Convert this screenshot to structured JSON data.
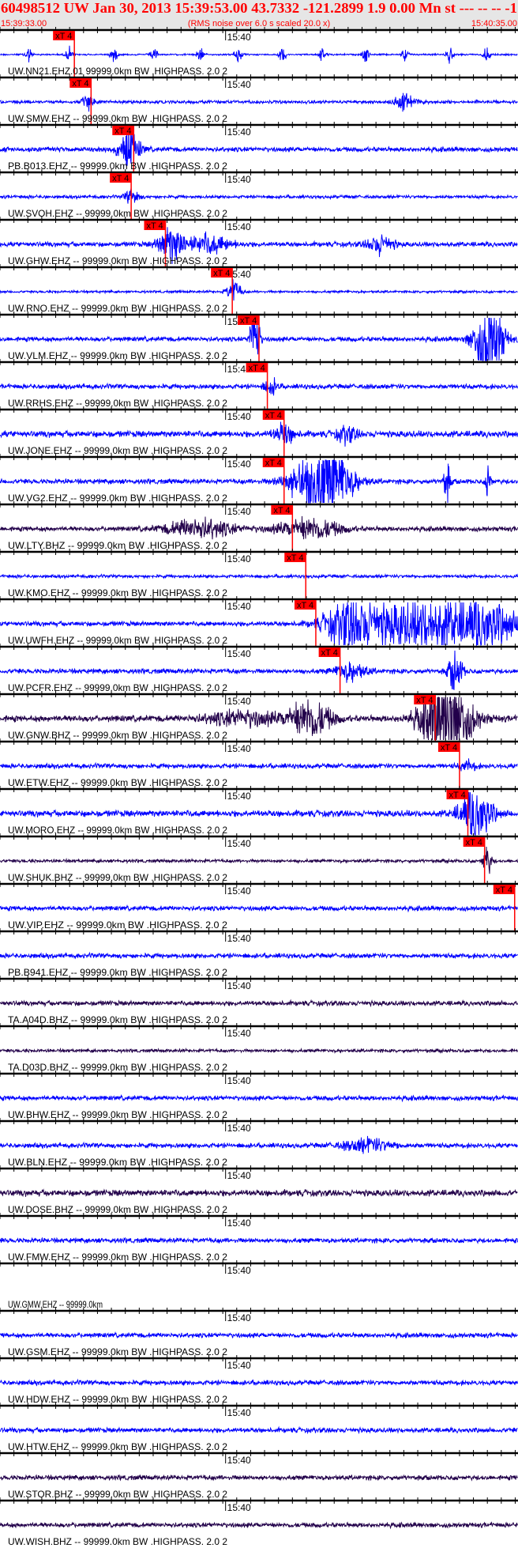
{
  "header": {
    "title": "60498512 UW Jan 30, 2013 15:39:53.00   43.7332 -121.2899  1.9 0.00 Mn st --- -- --  -1",
    "start_time": "15:39:33.00",
    "note": "(RMS noise over 6.0 s scaled 20.0 x)",
    "end_time": "15:40:35.00"
  },
  "colors": {
    "header_bg": "#e6e6e6",
    "accent": "#ff0000",
    "trace_blue": "#0000ff",
    "trace_dark": "#22004a",
    "axis": "#000000"
  },
  "chart_data": {
    "type": "line",
    "title": "60498512 UW Jan 30, 2013 15:39:53.00",
    "x_range_seconds": [
      0,
      62
    ],
    "x_start": "15:39:33.00",
    "x_end": "15:40:35.00",
    "time_mark_label": "15:40",
    "time_mark_seconds": 27,
    "major_tick_seconds": 10,
    "pick_label": "xT 4",
    "traces": [
      {
        "label": "UW.NN21.EHZ.01 99999.0km BW .HIGHPASS. 2.0  2",
        "color": "blue",
        "noise": 1,
        "pick": 8.9,
        "bursts": [
          [
            3.4,
            10,
            0.4
          ],
          [
            8.3,
            10,
            0.4
          ],
          [
            13.6,
            10,
            0.4
          ],
          [
            18.4,
            10,
            0.4
          ],
          [
            23.9,
            10,
            0.4
          ],
          [
            28.5,
            12,
            0.4
          ],
          [
            33.8,
            10,
            0.4
          ],
          [
            38.6,
            8,
            0.4
          ],
          [
            43.7,
            10,
            0.4
          ],
          [
            48.5,
            8,
            0.4
          ],
          [
            53.8,
            10,
            0.4
          ],
          [
            58.3,
            10,
            0.4
          ]
        ]
      },
      {
        "label": "UW.SMW.EHZ -- 99999.0km BW .HIGHPASS. 2.0  2",
        "color": "blue",
        "noise": 2,
        "pick": 10.9,
        "bursts": [
          [
            10.6,
            12,
            0.6
          ],
          [
            48.4,
            10,
            1.2
          ]
        ]
      },
      {
        "label": "PB.B013.EHZ -- 99999.0km BW .HIGHPASS. 2.0  2",
        "color": "blue",
        "noise": 3,
        "pick": 16.0,
        "bursts": [
          [
            15.5,
            25,
            1.2
          ]
        ]
      },
      {
        "label": "UW.SVOH.EHZ -- 99999.0km BW .HIGHPASS. 2.0  2",
        "color": "blue",
        "noise": 2,
        "pick": 15.7,
        "bursts": [
          [
            15.8,
            10,
            0.8
          ]
        ]
      },
      {
        "label": "UW.GHW.EHZ -- 99999.0km BW .HIGHPASS. 2.0  2",
        "color": "blue",
        "noise": 3,
        "pick": 19.8,
        "bursts": [
          [
            20.5,
            22,
            1.5
          ],
          [
            25,
            12,
            2.5
          ],
          [
            45.5,
            12,
            1.5
          ]
        ]
      },
      {
        "label": "UW.RNO.EHZ -- 99999.0km BW .HIGHPASS. 2.0  2",
        "color": "blue",
        "noise": 1.5,
        "pick": 27.8,
        "bursts": [
          [
            28,
            15,
            0.8
          ]
        ]
      },
      {
        "label": "UW.VLM.EHZ -- 99999.0km BW .HIGHPASS. 2.0  2",
        "color": "blue",
        "noise": 3,
        "pick": 31.0,
        "bursts": [
          [
            30.5,
            60,
            0.5
          ],
          [
            58.5,
            60,
            1.6
          ]
        ]
      },
      {
        "label": "UW.RRHS.EHZ -- 99999.0km BW .HIGHPASS. 2.0  2",
        "color": "blue",
        "noise": 3,
        "pick": 32.0,
        "bursts": [
          [
            32.5,
            10,
            0.8
          ]
        ]
      },
      {
        "label": "UW.JONE.EHZ -- 99999.0km BW .HIGHPASS. 2.0  2",
        "color": "blue",
        "noise": 4,
        "pick": 34.0,
        "bursts": [
          [
            34,
            12,
            1.2
          ],
          [
            41.5,
            10,
            1.2
          ]
        ]
      },
      {
        "label": "UW.VG2.EHZ -- 99999.0km BW .HIGHPASS. 2.0  2",
        "color": "blue",
        "noise": 3,
        "pick": 34.0,
        "bursts": [
          [
            38.5,
            60,
            3.2
          ],
          [
            53.5,
            25,
            0.4
          ],
          [
            58.5,
            30,
            0.3
          ]
        ]
      },
      {
        "label": "UW.LTY.BHZ -- 99999.0km BW .HIGHPASS. 2.0  2",
        "color": "dark",
        "noise": 3,
        "pick": 35.0,
        "bursts": [
          [
            24,
            12,
            4
          ],
          [
            37,
            14,
            3.5
          ]
        ]
      },
      {
        "label": "UW.KMO.EHZ -- 99999.0km BW .HIGHPASS. 2.0  2",
        "color": "blue",
        "noise": 2,
        "pick": 36.6,
        "bursts": []
      },
      {
        "label": "UW.UWFH.EHZ -- 99999.0km BW .HIGHPASS. 2.0  2",
        "color": "blue",
        "noise": 3,
        "pick": 37.8,
        "bursts": [
          [
            42,
            30,
            3
          ],
          [
            50,
            30,
            6
          ],
          [
            58,
            28,
            4
          ]
        ]
      },
      {
        "label": "UW.PCFR.EHZ -- 99999.0km BW .HIGHPASS. 2.0  2",
        "color": "blue",
        "noise": 3,
        "pick": 40.7,
        "bursts": [
          [
            42,
            12,
            1.8
          ],
          [
            54.5,
            25,
            0.8
          ]
        ]
      },
      {
        "label": "UW.GNW.BHZ -- 99999.0km BW .HIGHPASS. 2.0  2",
        "color": "dark",
        "noise": 4,
        "pick": 52.1,
        "bursts": [
          [
            29,
            10,
            4
          ],
          [
            37,
            25,
            2.5
          ],
          [
            53.5,
            60,
            2.8
          ]
        ]
      },
      {
        "label": "UW.ETW.EHZ -- 99999.0km BW .HIGHPASS. 2.0  2",
        "color": "blue",
        "noise": 3,
        "pick": 55.0,
        "bursts": [
          [
            56,
            6,
            1
          ]
        ]
      },
      {
        "label": "UW.MORO.EHZ -- 99999.0km BW .HIGHPASS. 2.0  2",
        "color": "blue",
        "noise": 4,
        "pick": 56.0,
        "bursts": [
          [
            57,
            35,
            1.8
          ]
        ]
      },
      {
        "label": "UW.SHUK.BHZ -- 99999.0km BW .HIGHPASS. 2.0  2",
        "color": "dark",
        "noise": 2,
        "pick": 58.0,
        "bursts": [
          [
            58.3,
            20,
            0.5
          ]
        ]
      },
      {
        "label": "UW.VIP.EHZ -- 99999.0km BW .HIGHPASS. 2.0  2",
        "color": "blue",
        "noise": 3,
        "pick": 61.6,
        "bursts": []
      },
      {
        "label": "PB.B941.EHZ -- 99999.0km BW .HIGHPASS. 2.0  2",
        "color": "blue",
        "noise": 3,
        "pick": null,
        "bursts": []
      },
      {
        "label": "TA.A04D.BHZ -- 99999.0km BW .HIGHPASS. 2.0  2",
        "color": "dark",
        "noise": 3,
        "pick": null,
        "bursts": []
      },
      {
        "label": "TA.D03D.BHZ -- 99999.0km BW .HIGHPASS. 2.0  2",
        "color": "dark",
        "noise": 2,
        "pick": null,
        "bursts": []
      },
      {
        "label": "UW.BHW.EHZ -- 99999.0km BW .HIGHPASS. 2.0  2",
        "color": "blue",
        "noise": 3,
        "pick": null,
        "bursts": []
      },
      {
        "label": "UW.BLN.EHZ -- 99999.0km BW .HIGHPASS. 2.0  2",
        "color": "blue",
        "noise": 3,
        "pick": null,
        "bursts": [
          [
            44,
            8,
            3
          ]
        ]
      },
      {
        "label": "UW.DOSE.BHZ -- 99999.0km BW .HIGHPASS. 2.0  2",
        "color": "dark",
        "noise": 4,
        "pick": null,
        "bursts": []
      },
      {
        "label": "UW.FMW.EHZ -- 99999.0km BW .HIGHPASS. 2.0  2",
        "color": "blue",
        "noise": 3,
        "pick": null,
        "bursts": []
      },
      {
        "label": "UW.GMW.EHZ -- 99999.0km",
        "color": "none",
        "noise": 0,
        "pick": null,
        "bursts": []
      },
      {
        "label": "UW.GSM.EHZ -- 99999.0km BW .HIGHPASS. 2.0  2",
        "color": "blue",
        "noise": 3,
        "pick": null,
        "bursts": []
      },
      {
        "label": "UW.HDW.EHZ -- 99999.0km BW .HIGHPASS. 2.0  2",
        "color": "blue",
        "noise": 3,
        "pick": null,
        "bursts": []
      },
      {
        "label": "UW.HTW.EHZ -- 99999.0km BW .HIGHPASS. 2.0  2",
        "color": "blue",
        "noise": 3,
        "pick": null,
        "bursts": []
      },
      {
        "label": "UW.STOR.BHZ -- 99999.0km BW .HIGHPASS. 2.0  2",
        "color": "dark",
        "noise": 3,
        "pick": null,
        "bursts": []
      },
      {
        "label": "UW.WISH.BHZ -- 99999.0km BW .HIGHPASS. 2.0  2",
        "color": "dark",
        "noise": 3,
        "pick": null,
        "bursts": []
      }
    ]
  }
}
